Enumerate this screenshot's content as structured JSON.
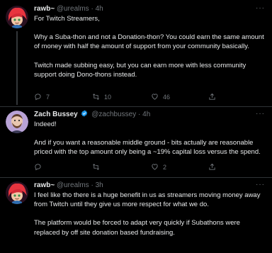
{
  "tweets": [
    {
      "display_name": "rawb~",
      "handle": "@urealms",
      "separator": "·",
      "time": "4h",
      "paragraphs": [
        "For Twitch Streamers,",
        "Why a Suba-thon and not a Donation-thon? You could earn the same amount of money with half the amount of support from your community basically.",
        "Twitch made subbing easy, but you can earn more with less community support doing Dono-thons instead."
      ],
      "reply_count": "7",
      "retweet_count": "10",
      "like_count": "46",
      "more_label": "···"
    },
    {
      "display_name": "Zach Bussey",
      "handle": "@zachbussey",
      "separator": "·",
      "time": "4h",
      "paragraphs": [
        "Indeed!",
        "And if you want a reasonable middle ground - bits actually are reasonable priced with the top amount only being a ~19% capital loss versus the spend."
      ],
      "reply_count": "",
      "retweet_count": "",
      "like_count": "2",
      "more_label": "···"
    },
    {
      "display_name": "rawb~",
      "handle": "@urealms",
      "separator": "·",
      "time": "3h",
      "paragraphs": [
        "I feel like tho there is a huge benefit in us as streamers moving money away from Twitch until they give us more respect for what we do.",
        "The platform would be forced to adapt very quickly if Subathons were replaced by off site donation based fundraising."
      ],
      "reply_count": "",
      "retweet_count": "",
      "like_count": "",
      "more_label": "···"
    }
  ],
  "colors": {
    "background": "#000000",
    "text_primary": "#e7e9ea",
    "text_secondary": "#71767b",
    "verified_blue": "#1d9bf0",
    "divider": "#2f3336"
  },
  "icons": {
    "reply": "reply-icon",
    "retweet": "retweet-icon",
    "like": "heart-icon",
    "share": "share-icon",
    "more": "more-icon",
    "verified": "verified-badge-icon"
  }
}
